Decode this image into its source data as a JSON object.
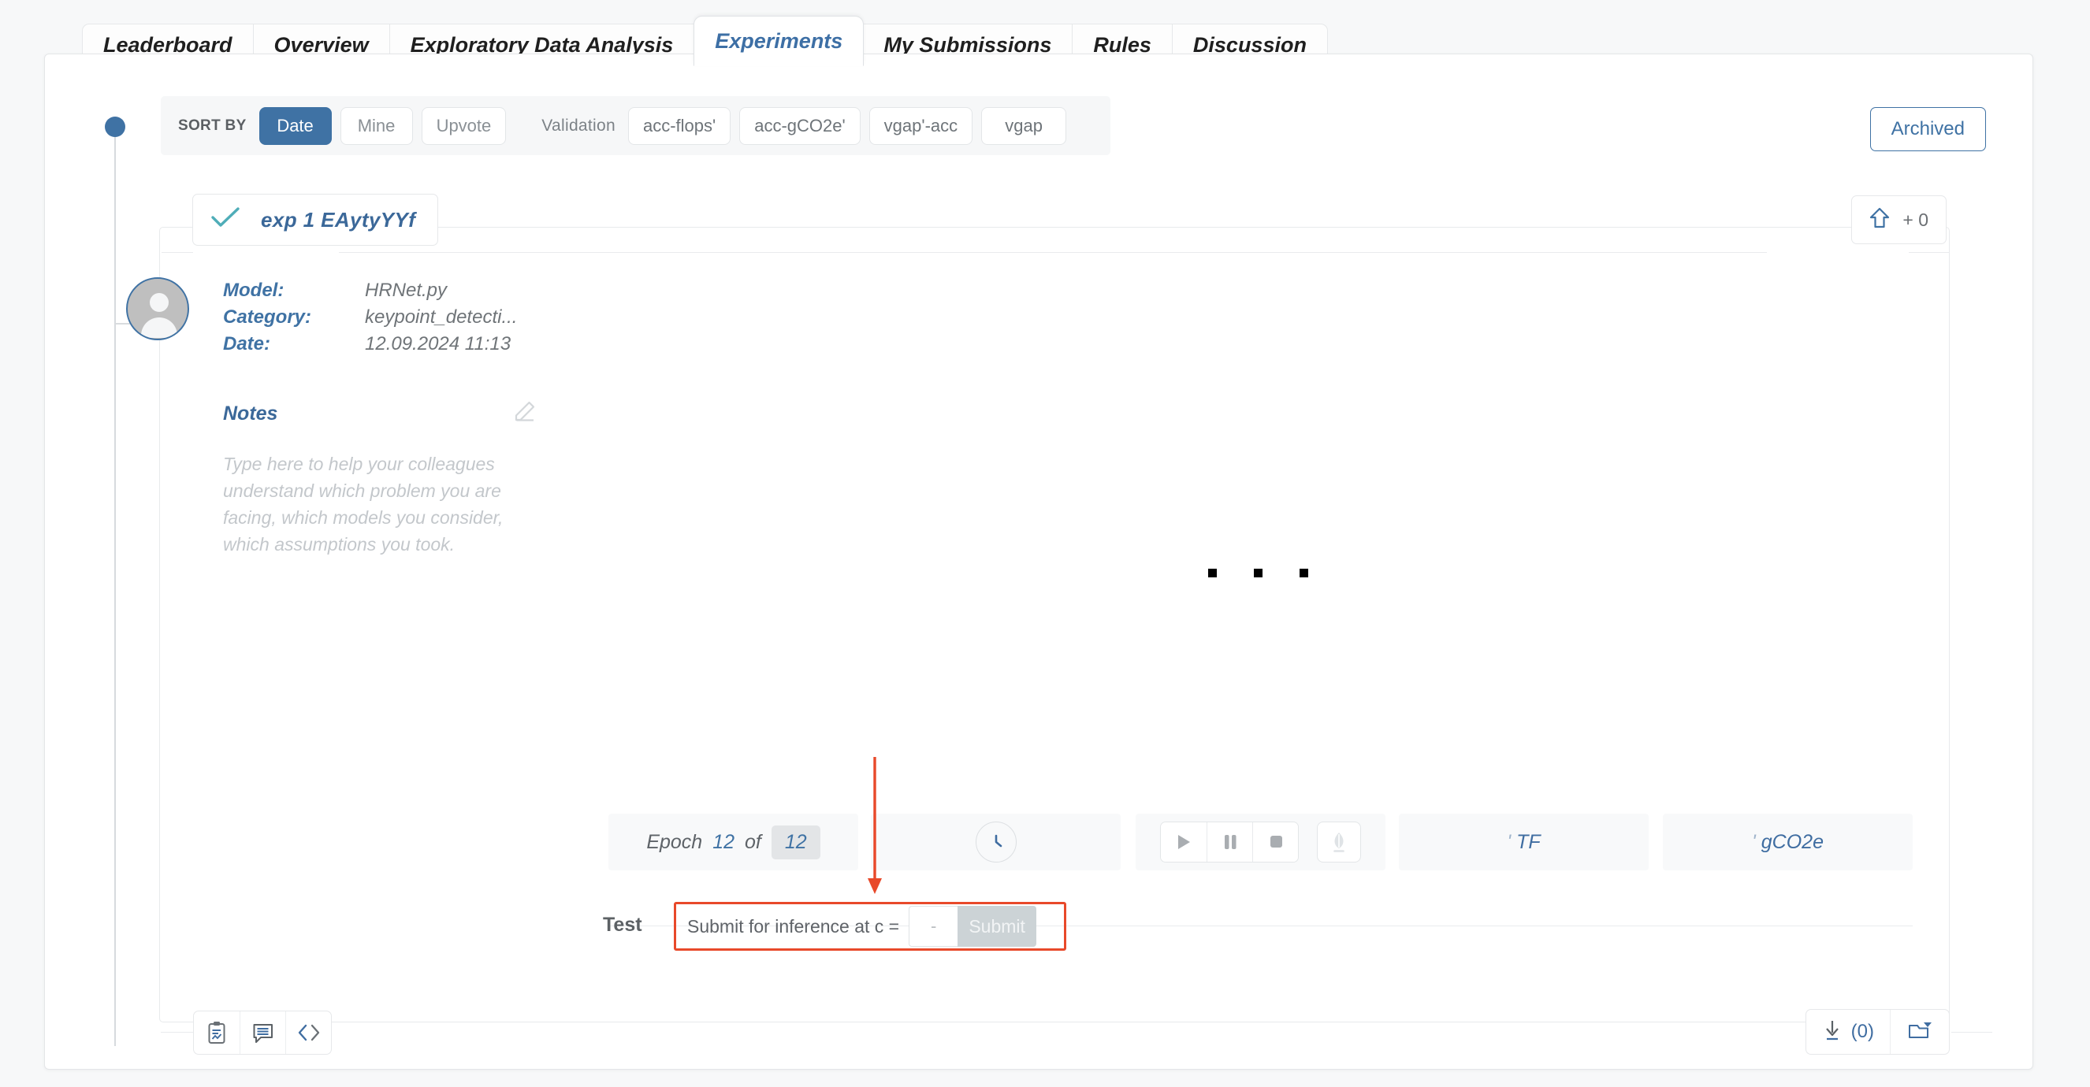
{
  "tabs": [
    {
      "label": "Leaderboard",
      "active": false
    },
    {
      "label": "Overview",
      "active": false
    },
    {
      "label": "Exploratory Data Analysis",
      "active": false
    },
    {
      "label": "Experiments",
      "active": true
    },
    {
      "label": "My Submissions",
      "active": false
    },
    {
      "label": "Rules",
      "active": false
    },
    {
      "label": "Discussion",
      "active": false
    }
  ],
  "sortbar": {
    "sort_by_label": "SORT BY",
    "sort_options": [
      {
        "label": "Date",
        "selected": true
      },
      {
        "label": "Mine",
        "selected": false
      },
      {
        "label": "Upvote",
        "selected": false
      }
    ],
    "validation_label": "Validation",
    "validation_metrics": [
      {
        "label": "acc-flops'"
      },
      {
        "label": "acc-gCO2e'"
      },
      {
        "label": "vgap'-acc"
      },
      {
        "label": "vgap"
      }
    ]
  },
  "archived_button": {
    "label": "Archived"
  },
  "experiment": {
    "title": "exp 1  EAytyYYf",
    "check_icon": "check-icon",
    "upvote": {
      "icon": "upvote-arrow-icon",
      "count": "+ 0"
    },
    "avatar_icon": "user-avatar-icon",
    "meta": [
      {
        "key": "Model:",
        "value": "HRNet.py"
      },
      {
        "key": "Category:",
        "value": "keypoint_detecti..."
      },
      {
        "key": "Date:",
        "value": "12.09.2024 11:13"
      }
    ],
    "notes": {
      "title": "Notes",
      "edit_icon": "pencil-edit-icon",
      "placeholder": "Type here to help your colleagues understand which problem you are facing, which models you consider, which assumptions you took."
    },
    "loading_indicator": "loading-dots",
    "metrics_strip": {
      "epoch": {
        "label": "Epoch",
        "current": "12",
        "of_label": "of",
        "total": "12"
      },
      "clock_icon": "clock-icon",
      "controls": [
        {
          "icon": "play-icon"
        },
        {
          "icon": "pause-icon"
        },
        {
          "icon": "stop-icon"
        }
      ],
      "eco_icon": "leaf-eco-icon",
      "tf": {
        "tick": "'",
        "label": "TF"
      },
      "co2": {
        "tick": "'",
        "label": "gCO2e"
      }
    },
    "test_row": {
      "label": "Test",
      "prompt": "Submit for inference at c =",
      "input_placeholder": "-",
      "input_value": "",
      "submit_label": "Submit"
    },
    "footer_left": [
      {
        "icon": "report-clipboard-icon"
      },
      {
        "icon": "comment-icon"
      },
      {
        "icon": "code-brackets-icon"
      }
    ],
    "footer_right": {
      "download": {
        "icon": "download-icon",
        "count": "(0)"
      },
      "folder": {
        "icon": "folder-open-icon"
      }
    }
  },
  "annotation": {
    "arrow_icon": "red-down-arrow",
    "highlight_color": "#e8492a"
  },
  "colors": {
    "accent_blue": "#3f72a4",
    "title_blue": "#3b6899",
    "teal_check": "#4fadb8",
    "annotation_red": "#e8492a",
    "panel_bg": "#ffffff",
    "page_bg": "#f7f8f9",
    "strip_bg": "#f8f9fa"
  }
}
